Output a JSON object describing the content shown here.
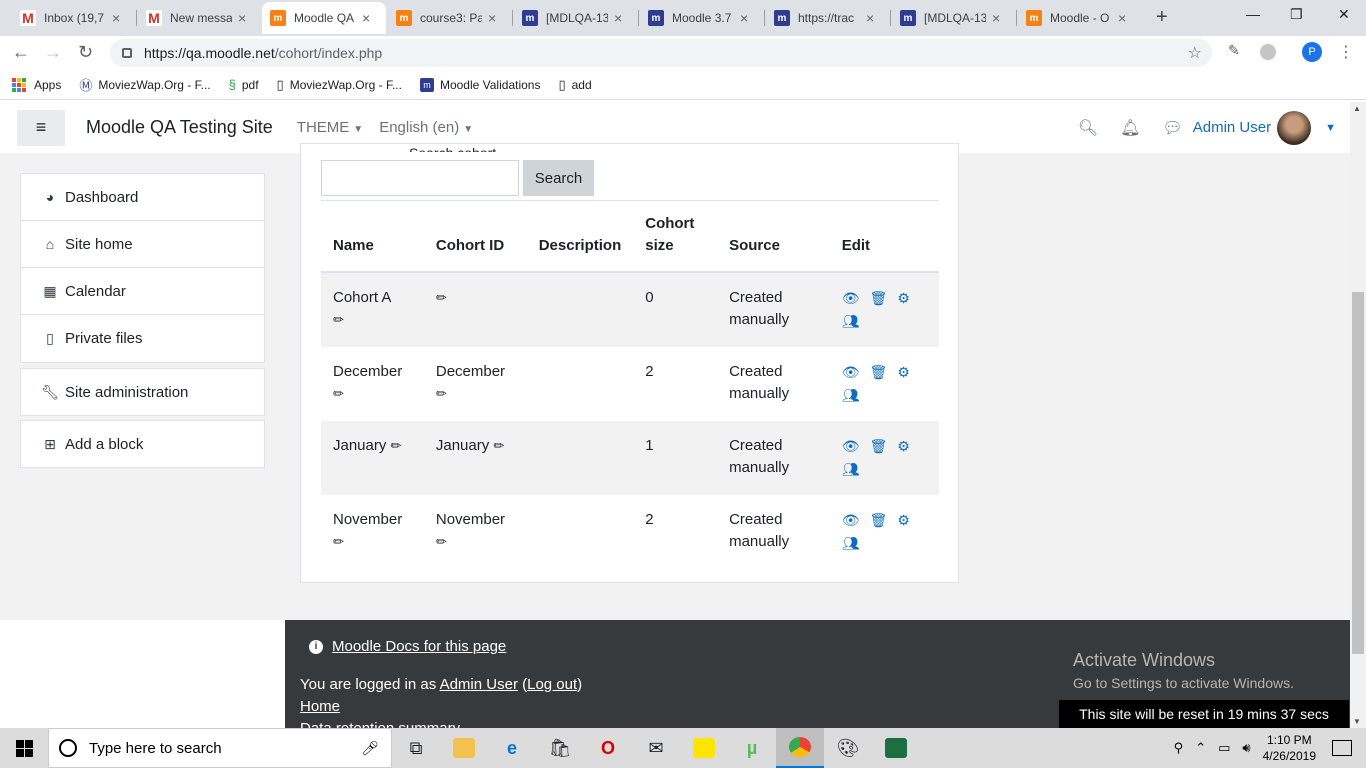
{
  "browser": {
    "tabs": [
      {
        "label": "Inbox (19,7",
        "favicon": "gmail"
      },
      {
        "label": "New messa",
        "favicon": "gmail"
      },
      {
        "label": "Moodle QA",
        "favicon": "moodle"
      },
      {
        "label": "course3: Pa",
        "favicon": "moodle"
      },
      {
        "label": "[MDLQA-13",
        "favicon": "jira"
      },
      {
        "label": "Moodle 3.7",
        "favicon": "jira"
      },
      {
        "label": "https://trac",
        "favicon": "jira"
      },
      {
        "label": "[MDLQA-13",
        "favicon": "jira"
      },
      {
        "label": "Moodle - O",
        "favicon": "moodle"
      }
    ],
    "active_tab": 2,
    "url_host": "https://qa.moodle.net",
    "url_path": "/cohort/index.php",
    "profile_initial": "P",
    "bookmarks": [
      {
        "label": "Apps"
      },
      {
        "label": "MoviezWap.Org - F..."
      },
      {
        "label": "pdf"
      },
      {
        "label": "MoviezWap.Org - F..."
      },
      {
        "label": "Moodle Validations"
      },
      {
        "label": "add"
      }
    ]
  },
  "navbar": {
    "site_name": "Moodle QA Testing Site",
    "theme_menu": "THEME",
    "language_menu": "English (en)",
    "user_name": "Admin User"
  },
  "nav_block": {
    "items": [
      {
        "label": "Dashboard",
        "icon": "dashboard-icon"
      },
      {
        "label": "Site home",
        "icon": "home-icon"
      },
      {
        "label": "Calendar",
        "icon": "calendar-icon"
      },
      {
        "label": "Private files",
        "icon": "file-icon"
      }
    ],
    "site_admin": "Site administration",
    "add_block": "Add a block"
  },
  "cohorts": {
    "search_label": "Search cohort",
    "search_button": "Search",
    "columns": [
      "Name",
      "Cohort ID",
      "Description",
      "Cohort size",
      "Source",
      "Edit"
    ],
    "rows": [
      {
        "name": "Cohort A",
        "id": "",
        "description": "",
        "size": "0",
        "source": "Created manually"
      },
      {
        "name": "December",
        "id": "December",
        "description": "",
        "size": "2",
        "source": "Created manually"
      },
      {
        "name": "January",
        "id": "January",
        "description": "",
        "size": "1",
        "source": "Created manually"
      },
      {
        "name": "November",
        "id": "November",
        "description": "",
        "size": "2",
        "source": "Created manually"
      }
    ]
  },
  "footer": {
    "docs_link": "Moodle Docs for this page",
    "logged_in_prefix": "You are logged in as ",
    "logged_in_user": "Admin User",
    "logout": "Log out",
    "home": "Home",
    "retention": "Data retention summary",
    "activate_title": "Activate Windows",
    "activate_sub": "Go to Settings to activate Windows.",
    "reset_notice": "This site will be reset in 19 mins 37 secs"
  },
  "taskbar": {
    "search_placeholder": "Type here to search",
    "time": "1:10 PM",
    "date": "4/26/2019"
  },
  "colors": {
    "link": "#0f6cbf",
    "footer_bg": "#373a3c",
    "page_bg": "#f2f2f2"
  }
}
